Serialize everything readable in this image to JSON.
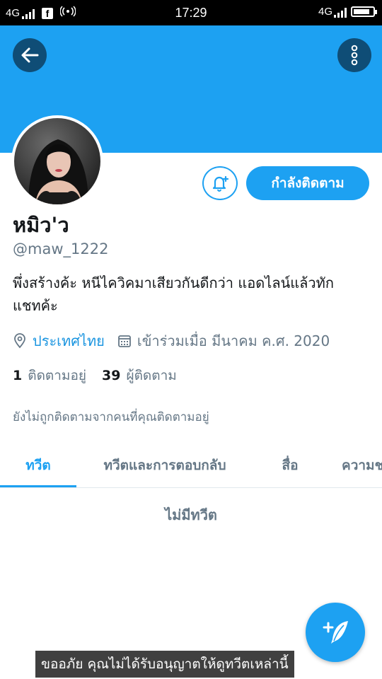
{
  "status_bar": {
    "network": "4G",
    "network_right": "4G",
    "time": "17:29",
    "facebook_glyph": "f",
    "battery_level": 0.85
  },
  "profile": {
    "name": "หมิว'ว",
    "handle": "@maw_1222",
    "bio": "พึ่งสร้างค้ะ หนีไควิคมาเสียวกันดีกว่า แอดไลน์แล้วทักแชทค้ะ",
    "location": "ประเทศไทย",
    "joined": "เข้าร่วมเมื่อ มีนาคม ค.ศ. 2020",
    "following_count": "1",
    "following_label": "ติดตามอยู่",
    "followers_count": "39",
    "followers_label": "ผู้ติดตาม",
    "not_followed_note": "ยังไม่ถูกติดตามจากคนที่คุณติดตามอยู่"
  },
  "actions": {
    "follow_label": "กำลังติดตาม"
  },
  "tabs": [
    {
      "label": "ทวีต",
      "active": true
    },
    {
      "label": "ทวีตและการตอบกลับ",
      "active": false
    },
    {
      "label": "สื่อ",
      "active": false
    },
    {
      "label": "ความชอบ",
      "active": false
    }
  ],
  "empty_state": "ไม่มีทวีต",
  "toast": "ขออภัย คุณไม่ได้รับอนุญาตให้ดูทวีตเหล่านี้",
  "icons": {
    "back": "arrow-left-icon",
    "more": "more-vertical-icon",
    "bell": "bell-plus-icon",
    "location": "location-pin-icon",
    "calendar": "calendar-icon",
    "compose": "compose-tweet-icon"
  },
  "colors": {
    "accent": "#1da1f2",
    "dark_button": "#0f4d76",
    "secondary_text": "#657786",
    "link": "#1b95e0"
  }
}
